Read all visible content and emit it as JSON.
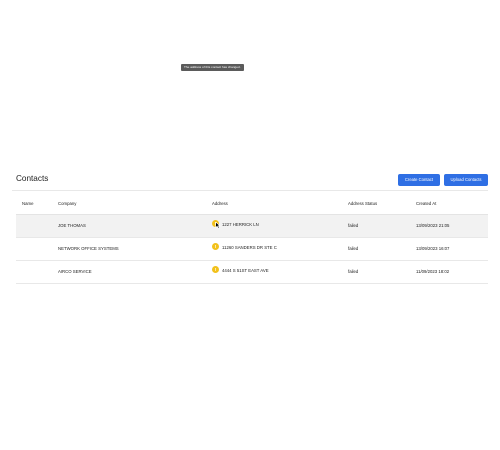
{
  "header": {
    "title": "Contacts",
    "create_label": "Create Contact",
    "upload_label": "Upload Contacts"
  },
  "table": {
    "columns": [
      "Name",
      "Company",
      "Address",
      "Address Status",
      "Created At"
    ],
    "rows": [
      {
        "name": "",
        "company": "JOE THOMAS",
        "address": "1227 HERRICK LN",
        "status": "failed",
        "created": "13/09/2023 21:05"
      },
      {
        "name": "",
        "company": "NETWORK OFFICE SYSTEMS",
        "address": "11260 SANDERS DR STE C",
        "status": "failed",
        "created": "13/09/2023 16:07"
      },
      {
        "name": "",
        "company": "AIRCO SERVICE",
        "address": "4444 S 51ST EAST AVE",
        "status": "failed",
        "created": "11/09/2023 18:02"
      }
    ]
  },
  "tooltip": {
    "text": "The address of this contact has changed."
  },
  "icons": {
    "warning": "warning-icon",
    "cursor": "cursor-icon"
  },
  "colors": {
    "primary_button": "#2f6fe4",
    "warning": "#f2c11b",
    "tooltip": "#5b5b5b"
  }
}
